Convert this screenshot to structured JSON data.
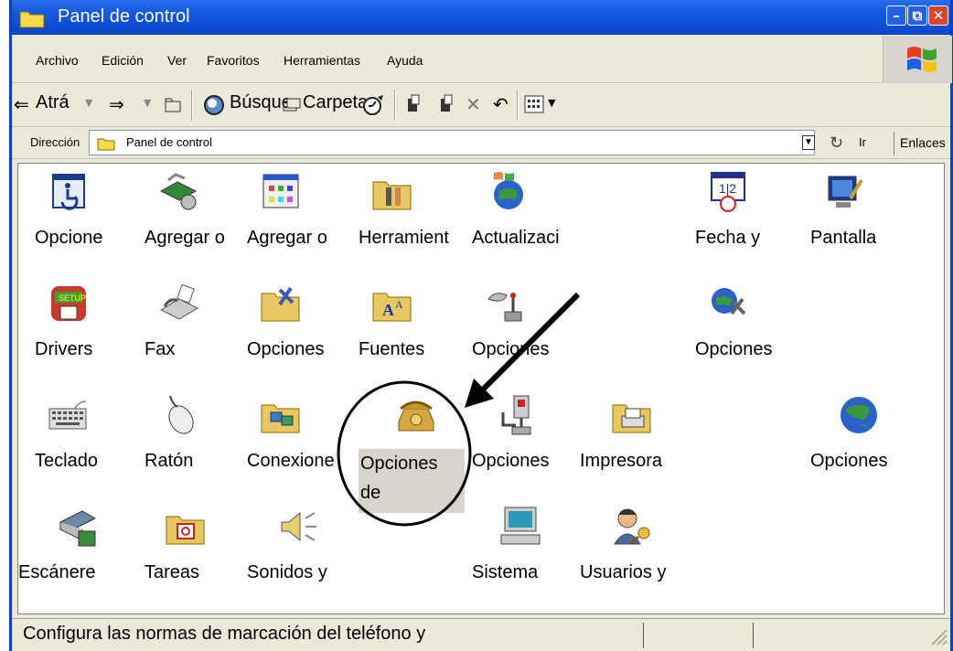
{
  "window": {
    "title": "Panel de control"
  },
  "menu": {
    "items": [
      "Archivo",
      "Edición",
      "Ver",
      "Favoritos",
      "Herramientas",
      "Ayuda"
    ]
  },
  "toolbar": {
    "back_label": "Atrá",
    "search_label": "Búsque",
    "folders_label": "Carpeta"
  },
  "address": {
    "label": "Dirección",
    "value": "Panel de control",
    "go_label": "Ir",
    "links_label": "Enlaces"
  },
  "items": [
    {
      "label": "Opcione",
      "icon": "accessibility-icon"
    },
    {
      "label": "Agregar o",
      "icon": "add-hardware-icon"
    },
    {
      "label": "Agregar o",
      "icon": "add-remove-programs-icon"
    },
    {
      "label": "Herramient",
      "icon": "admin-tools-icon"
    },
    {
      "label": "Actualizaci",
      "icon": "windows-update-icon"
    },
    {
      "label": "Fecha y",
      "icon": "date-time-icon"
    },
    {
      "label": "Pantalla",
      "icon": "display-icon"
    },
    {
      "label": "Drivers",
      "icon": "drivers-icon"
    },
    {
      "label": "Fax",
      "icon": "fax-icon"
    },
    {
      "label": "Opciones",
      "icon": "folder-options-icon"
    },
    {
      "label": "Fuentes",
      "icon": "fonts-icon"
    },
    {
      "label": "Opciones",
      "icon": "game-controllers-icon"
    },
    {
      "label": "Opciones",
      "icon": "internet-options-icon"
    },
    {
      "label": "Teclado",
      "icon": "keyboard-icon"
    },
    {
      "label": "Ratón",
      "icon": "mouse-icon"
    },
    {
      "label": "Conexione",
      "icon": "network-connections-icon"
    },
    {
      "label": "Opciones de",
      "icon": "phone-modem-icon"
    },
    {
      "label": "Opciones",
      "icon": "power-options-icon"
    },
    {
      "label": "Impresora",
      "icon": "printers-icon"
    },
    {
      "label": "Opciones",
      "icon": "regional-options-icon"
    },
    {
      "label": "Escánere",
      "icon": "scanners-icon"
    },
    {
      "label": "Tareas",
      "icon": "scheduled-tasks-icon"
    },
    {
      "label": "Sonidos y",
      "icon": "sounds-icon"
    },
    {
      "label": "Sistema",
      "icon": "system-icon"
    },
    {
      "label": "Usuarios y",
      "icon": "users-icon"
    }
  ],
  "status": {
    "text": "Configura las normas de marcación del teléfono y"
  }
}
